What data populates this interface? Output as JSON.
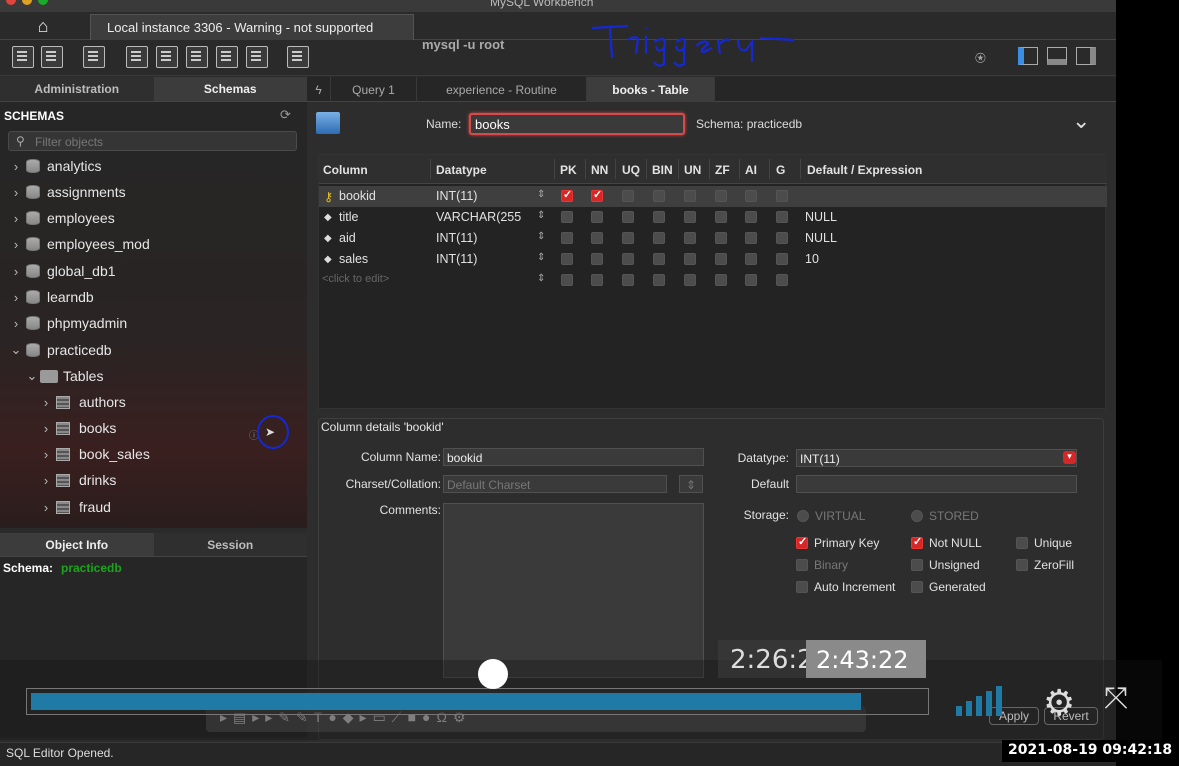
{
  "window": {
    "title": "MySQL Workbench"
  },
  "connection_tab": {
    "label": "Local instance 3306 - Warning - not supported"
  },
  "overlay_text": {
    "command": "mysql -u root",
    "annotation": "Triggers"
  },
  "left_tabs": [
    "Administration",
    "Schemas"
  ],
  "schemas": {
    "title": "SCHEMAS",
    "filter_placeholder": "Filter objects",
    "databases": [
      "analytics",
      "assignments",
      "employees",
      "employees_mod",
      "global_db1",
      "learndb",
      "phpmyadmin",
      "practicedb"
    ],
    "tables_label": "Tables",
    "tables": [
      "authors",
      "books",
      "book_sales",
      "drinks",
      "fraud"
    ]
  },
  "lower_tabs": [
    "Object Info",
    "Session"
  ],
  "object_info": {
    "schema_label": "Schema:",
    "schema_value": "practicedb"
  },
  "editor_tabs": [
    "Query 1",
    "experience - Routine",
    "books - Table"
  ],
  "table_editor": {
    "name_label": "Name:",
    "name_value": "books",
    "schema_label": "Schema:  practicedb",
    "columns_header": [
      "Column",
      "Datatype",
      "PK",
      "NN",
      "UQ",
      "BIN",
      "UN",
      "ZF",
      "AI",
      "G",
      "Default / Expression"
    ],
    "rows": [
      {
        "name": "bookid",
        "type": "INT(11)",
        "flags": [
          1,
          1,
          0,
          0,
          0,
          0,
          0,
          0
        ],
        "default": ""
      },
      {
        "name": "title",
        "type": "VARCHAR(255",
        "flags": [
          0,
          0,
          0,
          0,
          0,
          0,
          0,
          0
        ],
        "default": "NULL"
      },
      {
        "name": "aid",
        "type": "INT(11)",
        "flags": [
          0,
          0,
          0,
          0,
          0,
          0,
          0,
          0
        ],
        "default": "NULL"
      },
      {
        "name": "sales",
        "type": "INT(11)",
        "flags": [
          0,
          0,
          0,
          0,
          0,
          0,
          0,
          0
        ],
        "default": "10"
      },
      {
        "name": "<click to edit>",
        "type": "",
        "flags": [
          0,
          0,
          0,
          0,
          0,
          0,
          0,
          0
        ],
        "default": ""
      }
    ]
  },
  "column_details": {
    "title": "Column details 'bookid'",
    "column_name_label": "Column Name:",
    "column_name_value": "bookid",
    "charset_label": "Charset/Collation:",
    "charset_value": "Default Charset",
    "comments_label": "Comments:",
    "datatype_label": "Datatype:",
    "datatype_value": "INT(11)",
    "default_label": "Default",
    "storage_label": "Storage:",
    "virtual_label": "VIRTUAL",
    "stored_label": "STORED",
    "checks": [
      {
        "label": "Primary Key",
        "on": true,
        "disabled": false
      },
      {
        "label": "Not NULL",
        "on": true,
        "disabled": false
      },
      {
        "label": "Unique",
        "on": false,
        "disabled": false
      },
      {
        "label": "Binary",
        "on": false,
        "disabled": true
      },
      {
        "label": "Unsigned",
        "on": false,
        "disabled": false
      },
      {
        "label": "ZeroFill",
        "on": false,
        "disabled": false
      },
      {
        "label": "Auto Increment",
        "on": false,
        "disabled": false
      },
      {
        "label": "Generated",
        "on": false,
        "disabled": false
      }
    ],
    "apply_label": "Apply",
    "revert_label": "Revert"
  },
  "video_player": {
    "current_time": "2:26:2",
    "hover_time": "2:43:22",
    "progress_fraction": 0.93,
    "playhead_fraction": 0.5
  },
  "status": {
    "text": "SQL Editor Opened.",
    "timestamp": "2021-08-19  09:42:18"
  },
  "colors": {
    "accent_check": "#d42727",
    "schema_value": "#1aa51a",
    "progress": "#1f7ba6",
    "annotation": "#1528d6"
  }
}
